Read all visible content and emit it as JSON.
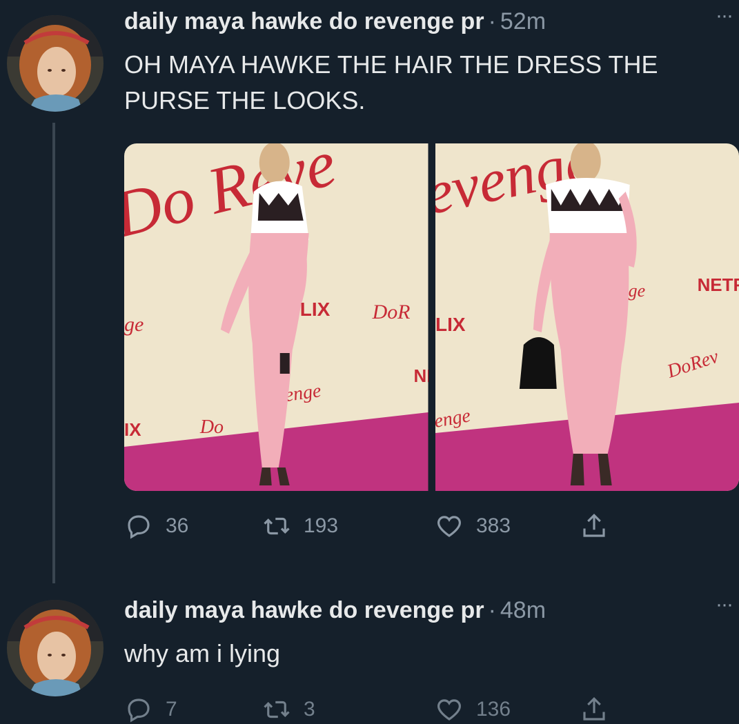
{
  "tweets": [
    {
      "name": "daily maya hawke do revenge pr",
      "separator": "·",
      "time": "52m",
      "more": "···",
      "text": "OH MAYA HAWKE THE HAIR THE DRESS THE PURSE THE LOOKS.",
      "replies": "36",
      "retweets": "193",
      "likes": "383",
      "photos": [
        {
          "backdrop": [
            "Do Reve",
            "ge",
            "FLIX",
            "DoR",
            "venge",
            "NE",
            "IX",
            "Do"
          ]
        },
        {
          "backdrop": [
            "evenge",
            "NETF",
            "LIX",
            "ge",
            "DoRev",
            "enge"
          ]
        }
      ]
    },
    {
      "name": "daily maya hawke do revenge pr",
      "separator": "·",
      "time": "48m",
      "more": "···",
      "text": "why am i lying",
      "replies": "7",
      "retweets": "3",
      "likes": "136"
    }
  ],
  "colors": {
    "background": "#15202b",
    "text": "#e7e9ea",
    "muted": "#8b98a5",
    "carpet": "#c0337f",
    "dress": "#f2aeb9",
    "backdrop": "#efe5cc",
    "logo_red": "#c72a36"
  }
}
